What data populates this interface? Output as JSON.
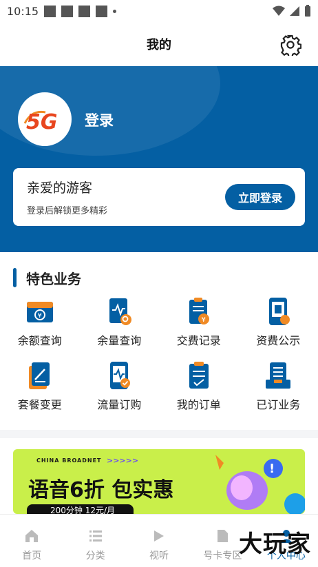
{
  "status": {
    "time": "10:15"
  },
  "header": {
    "title": "我的"
  },
  "profile": {
    "login_label": "登录",
    "logo_text": "5G"
  },
  "guest_card": {
    "title": "亲爱的游客",
    "subtitle": "登录后解锁更多精彩",
    "button": "立即登录"
  },
  "features": {
    "title": "特色业务",
    "items": [
      {
        "label": "余额查询",
        "icon": "balance-card-icon"
      },
      {
        "label": "余量查询",
        "icon": "usage-chart-icon"
      },
      {
        "label": "交费记录",
        "icon": "payment-record-icon"
      },
      {
        "label": "资费公示",
        "icon": "tariff-phone-icon"
      },
      {
        "label": "套餐变更",
        "icon": "plan-change-icon"
      },
      {
        "label": "流量订购",
        "icon": "data-order-icon"
      },
      {
        "label": "我的订单",
        "icon": "my-orders-icon"
      },
      {
        "label": "已订业务",
        "icon": "subscribed-services-icon"
      }
    ]
  },
  "banner": {
    "brand": "CHINA BROADNET",
    "chevrons": ">>>>>",
    "headline": "语音6折 包实惠",
    "pill_text": "200分钟 12元/月"
  },
  "tabbar": {
    "items": [
      {
        "label": "首页"
      },
      {
        "label": "分类"
      },
      {
        "label": "视听"
      },
      {
        "label": "号卡专区"
      },
      {
        "label": "个人中心"
      }
    ]
  },
  "watermark": "大玩家",
  "colors": {
    "primary": "#045fa3",
    "orange": "#f08a24",
    "banner": "#c9ef4a"
  }
}
